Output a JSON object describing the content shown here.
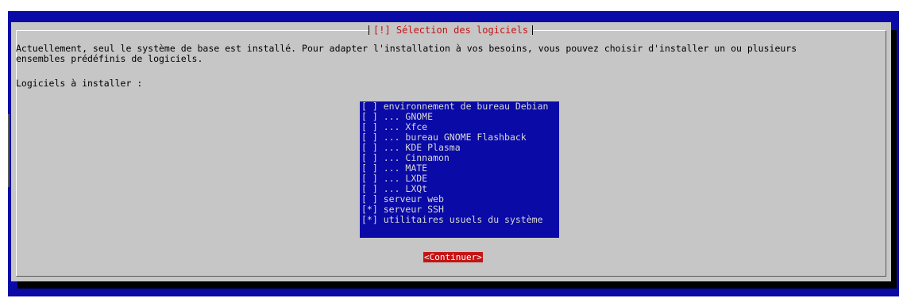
{
  "dialog": {
    "title": "[!] Sélection des logiciels",
    "intro_line1": "Actuellement, seul le système de base est installé. Pour adapter l'installation à vos besoins, vous pouvez choisir d'installer un ou plusieurs",
    "intro_line2": "ensembles prédéfinis de logiciels.",
    "list_label": "Logiciels à installer :",
    "continue_label": "<Continuer>"
  },
  "software_list": [
    {
      "checkbox": "[ ]",
      "label": "environnement de bureau Debian",
      "checked": false
    },
    {
      "checkbox": "[ ]",
      "label": "... GNOME",
      "checked": false
    },
    {
      "checkbox": "[ ]",
      "label": "... Xfce",
      "checked": false
    },
    {
      "checkbox": "[ ]",
      "label": "... bureau GNOME Flashback",
      "checked": false
    },
    {
      "checkbox": "[ ]",
      "label": "... KDE Plasma",
      "checked": false
    },
    {
      "checkbox": "[ ]",
      "label": "... Cinnamon",
      "checked": false
    },
    {
      "checkbox": "[ ]",
      "label": "... MATE",
      "checked": false
    },
    {
      "checkbox": "[ ]",
      "label": "... LXDE",
      "checked": false
    },
    {
      "checkbox": "[ ]",
      "label": "... LXQt",
      "checked": false
    },
    {
      "checkbox": "[ ]",
      "label": "serveur web",
      "checked": false
    },
    {
      "checkbox": "[*]",
      "label": "serveur SSH",
      "checked": true
    },
    {
      "checkbox": "[*]",
      "label": "utilitaires usuels du système",
      "checked": true
    }
  ],
  "colors": {
    "background_blue": "#0a0aa6",
    "dialog_grey": "#c6c6c6",
    "title_red": "#c41414",
    "button_red": "#c41414"
  }
}
